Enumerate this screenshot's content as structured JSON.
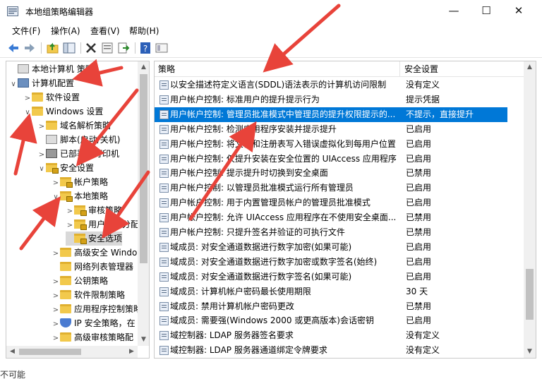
{
  "window": {
    "title": "本地组策略编辑器",
    "min_glyph": "—",
    "max_glyph": "☐",
    "close_glyph": "✕"
  },
  "menu": [
    "文件(F)",
    "操作(A)",
    "查看(V)",
    "帮助(H)"
  ],
  "toolbar": {
    "icons": [
      "back-icon",
      "forward-icon",
      "up-folder-icon",
      "show-hide-tree-icon",
      "delete-icon",
      "properties-icon",
      "export-icon",
      "help-icon",
      "view-icon"
    ]
  },
  "tree": [
    {
      "label": "本地计算机 策略",
      "icon": "policy-icon",
      "level": 0,
      "arrow": ""
    },
    {
      "label": "计算机配置",
      "icon": "computer-icon",
      "level": 0,
      "arrow": "∨"
    },
    {
      "label": "软件设置",
      "icon": "folder-icon",
      "level": 1,
      "arrow": ">"
    },
    {
      "label": "Windows 设置",
      "icon": "folder-icon",
      "level": 1,
      "arrow": "∨"
    },
    {
      "label": "域名解析策略",
      "icon": "folder-icon",
      "level": 2,
      "arrow": ">"
    },
    {
      "label": "脚本(启动/关机)",
      "icon": "script-icon",
      "level": 2,
      "arrow": ""
    },
    {
      "label": "已部署的打印机",
      "icon": "printer-icon",
      "level": 2,
      "arrow": ">"
    },
    {
      "label": "安全设置",
      "icon": "security-icon",
      "level": 2,
      "arrow": "∨"
    },
    {
      "label": "帐户策略",
      "icon": "folder-lock-icon",
      "level": 3,
      "arrow": ">"
    },
    {
      "label": "本地策略",
      "icon": "folder-lock-icon",
      "level": 3,
      "arrow": "∨"
    },
    {
      "label": "审核策略",
      "icon": "folder-lock-icon",
      "level": 4,
      "arrow": ">"
    },
    {
      "label": "用户权限分配",
      "icon": "folder-lock-icon",
      "level": 4,
      "arrow": ">"
    },
    {
      "label": "安全选项",
      "icon": "folder-lock-icon",
      "level": 4,
      "arrow": "",
      "selected": true
    },
    {
      "label": "高级安全 Windows",
      "icon": "folder-icon",
      "level": 3,
      "arrow": ">"
    },
    {
      "label": "网络列表管理器",
      "icon": "folder-icon",
      "level": 3,
      "arrow": ""
    },
    {
      "label": "公钥策略",
      "icon": "folder-icon",
      "level": 3,
      "arrow": ">"
    },
    {
      "label": "软件限制策略",
      "icon": "folder-icon",
      "level": 3,
      "arrow": ">"
    },
    {
      "label": "应用程序控制策略",
      "icon": "folder-icon",
      "level": 3,
      "arrow": ">"
    },
    {
      "label": "IP 安全策略，在",
      "icon": "ip-security-icon",
      "level": 3,
      "arrow": ">"
    },
    {
      "label": "高级审核策略配",
      "icon": "folder-icon",
      "level": 3,
      "arrow": ">"
    }
  ],
  "list": {
    "col_policy": "策略",
    "col_setting": "安全设置",
    "rows": [
      {
        "name": "以安全描述符定义语言(SDDL)语法表示的计算机访问限制",
        "value": "没有定义"
      },
      {
        "name": "用户帐户控制: 标准用户的提升提示行为",
        "value": "提示凭据"
      },
      {
        "name": "用户帐户控制: 管理员批准模式中管理员的提升权限提示的...",
        "value": "不提示，直接提升",
        "selected": true
      },
      {
        "name": "用户帐户控制: 检测应用程序安装并提示提升",
        "value": "已启用"
      },
      {
        "name": "用户帐户控制: 将文件和注册表写入错误虚拟化到每用户位置",
        "value": "已启用"
      },
      {
        "name": "用户帐户控制: 仅提升安装在安全位置的 UIAccess 应用程序",
        "value": "已启用"
      },
      {
        "name": "用户帐户控制: 提示提升时切换到安全桌面",
        "value": "已禁用"
      },
      {
        "name": "用户帐户控制: 以管理员批准模式运行所有管理员",
        "value": "已启用"
      },
      {
        "name": "用户帐户控制: 用于内置管理员帐户的管理员批准模式",
        "value": "已启用"
      },
      {
        "name": "用户帐户控制: 允许 UIAccess 应用程序在不使用安全桌面...",
        "value": "已禁用"
      },
      {
        "name": "用户帐户控制: 只提升签名并验证的可执行文件",
        "value": "已禁用"
      },
      {
        "name": "域成员: 对安全通道数据进行数字加密(如果可能)",
        "value": "已启用"
      },
      {
        "name": "域成员: 对安全通道数据进行数字加密或数字签名(始终)",
        "value": "已启用"
      },
      {
        "name": "域成员: 对安全通道数据进行数字签名(如果可能)",
        "value": "已启用"
      },
      {
        "name": "域成员: 计算机帐户密码最长使用期限",
        "value": "30 天"
      },
      {
        "name": "域成员: 禁用计算机帐户密码更改",
        "value": "已禁用"
      },
      {
        "name": "域成员: 需要强(Windows 2000 或更高版本)会话密钥",
        "value": "已启用"
      },
      {
        "name": "域控制器: LDAP 服务器签名要求",
        "value": "没有定义"
      },
      {
        "name": "域控制器: LDAP 服务器通道绑定令牌要求",
        "value": "没有定义"
      }
    ]
  },
  "bottom_text": "不可能",
  "colors": {
    "selection": "#0078d7",
    "annotation_arrow": "#e8433a"
  }
}
